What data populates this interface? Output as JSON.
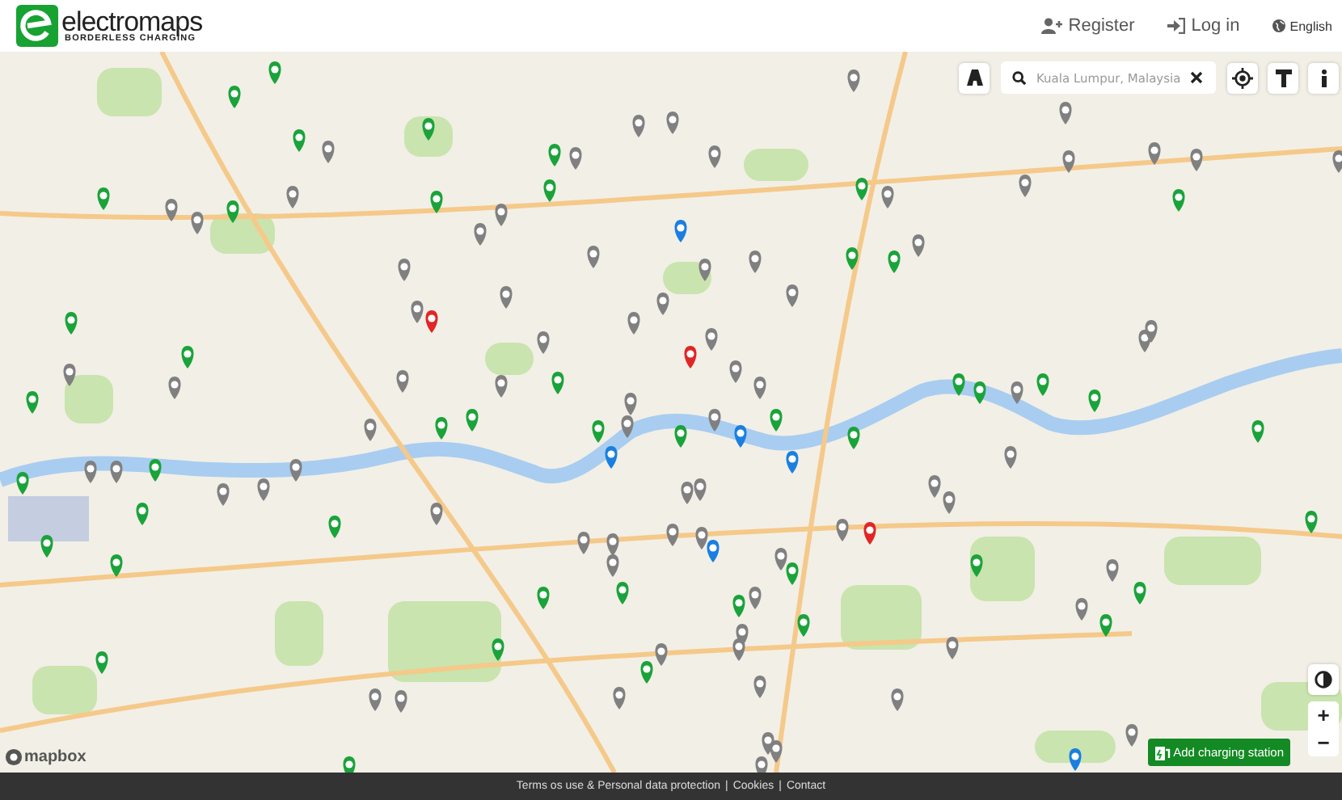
{
  "header": {
    "logo_name": "electromaps",
    "logo_tagline": "BORDERLESS CHARGING",
    "nav": [
      {
        "kind": "register",
        "label": "Register"
      },
      {
        "kind": "login",
        "label": "Log in"
      },
      {
        "kind": "language",
        "label": "English"
      }
    ]
  },
  "map": {
    "search": {
      "placeholder": "Kuala Lumpur, Malaysia"
    },
    "attribution": "mapbox",
    "controls": {
      "zoom_in": "+",
      "zoom_out": "−"
    },
    "add_button": "Add charging station"
  },
  "footer": {
    "links": [
      "Terms os use & Personal data protection",
      "Cookies",
      "Contact"
    ],
    "separator": "|"
  }
}
